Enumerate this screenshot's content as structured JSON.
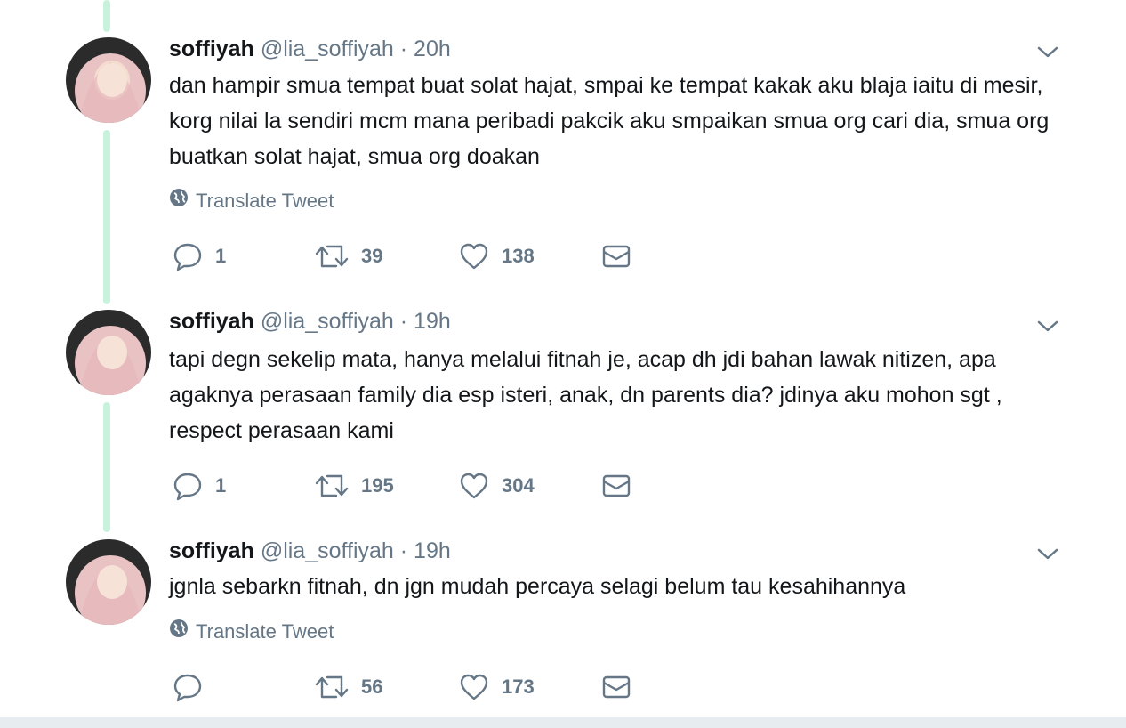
{
  "tweets": [
    {
      "name": "soffiyah",
      "handle": "@lia_soffiyah",
      "separator": "·",
      "time": "20h",
      "text": "dan hampir smua tempat buat solat hajat, smpai ke tempat kakak aku blaja iaitu di mesir, korg nilai la sendiri mcm mana peribadi pakcik aku smpaikan smua org cari dia, smua org buatkan solat hajat, smua org doakan",
      "translate_label": "Translate Tweet",
      "replies": "1",
      "retweets": "39",
      "likes": "138"
    },
    {
      "name": "soffiyah",
      "handle": "@lia_soffiyah",
      "separator": "·",
      "time": "19h",
      "text": "tapi degn sekelip mata, hanya melalui fitnah je, acap dh jdi bahan lawak nitizen, apa agaknya perasaan family dia esp isteri, anak, dn parents dia? jdinya aku mohon sgt , respect perasaan kami",
      "replies": "1",
      "retweets": "195",
      "likes": "304"
    },
    {
      "name": "soffiyah",
      "handle": "@lia_soffiyah",
      "separator": "·",
      "time": "19h",
      "text": "jgnla sebarkn fitnah, dn jgn mudah percaya selagi belum tau kesahihannya",
      "translate_label": "Translate Tweet",
      "replies": "",
      "retweets": "56",
      "likes": "173"
    }
  ],
  "icons": {
    "reply": "reply-icon",
    "retweet": "retweet-icon",
    "like": "heart-icon",
    "dm": "envelope-icon",
    "translate": "globe-icon",
    "more": "chevron-down-icon"
  },
  "colors": {
    "text": "#14171a",
    "secondary": "#657786",
    "thread_line": "#c9f2dd"
  }
}
